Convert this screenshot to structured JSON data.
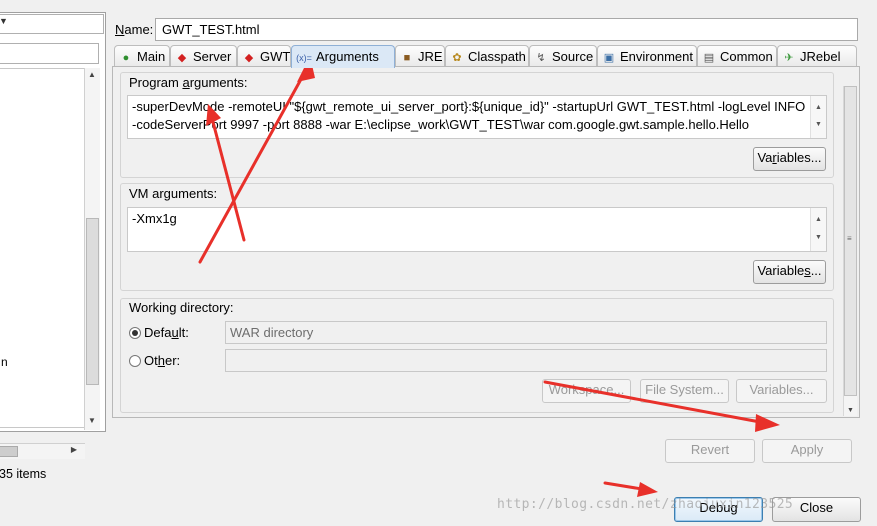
{
  "left": {
    "item_fragment": "n",
    "items_count": "35 items"
  },
  "name": {
    "label": "Name:",
    "value": "GWT_TEST.html"
  },
  "tabs": [
    {
      "label": "Main",
      "icon": "green-circle-c-icon"
    },
    {
      "label": "Server",
      "icon": "red-gwt-icon"
    },
    {
      "label": "GWT",
      "icon": "red-gwt-icon"
    },
    {
      "label": "Arguments",
      "icon": "arguments-x-equals-icon"
    },
    {
      "label": "JRE",
      "icon": "jre-books-icon"
    },
    {
      "label": "Classpath",
      "icon": "classpath-icon"
    },
    {
      "label": "Source",
      "icon": "source-icon"
    },
    {
      "label": "Environment",
      "icon": "environment-icon"
    },
    {
      "label": "Common",
      "icon": "common-icon"
    },
    {
      "label": "JRebel",
      "icon": "jrebel-icon"
    }
  ],
  "program_args": {
    "label": "Program arguments:",
    "line1": "-superDevMode -remoteUI \"${gwt_remote_ui_server_port}:${unique_id}\" -startupUrl GWT_TEST.html -logLevel INFO",
    "line2": "-codeServerPort 9997 -port 8888 -war E:\\eclipse_work\\GWT_TEST\\war com.google.gwt.sample.hello.Hello",
    "variables_label": "Variables..."
  },
  "vm_args": {
    "label": "VM arguments:",
    "value": "-Xmx1g",
    "variables_label": "Variables..."
  },
  "working_dir": {
    "label": "Working directory:",
    "default_label": "Default:",
    "default_value": "WAR directory",
    "other_label": "Other:",
    "other_value": "",
    "workspace_label": "Workspace...",
    "filesystem_label": "File System...",
    "variables_label": "Variables..."
  },
  "buttons": {
    "revert": "Revert",
    "apply": "Apply",
    "debug": "Debug",
    "close": "Close"
  },
  "watermark": "http://blog.csdn.net/zhaojuxin123525",
  "colors": {
    "active_tab": "#dbe8f6",
    "annotation_arrow": "#e8302a"
  }
}
